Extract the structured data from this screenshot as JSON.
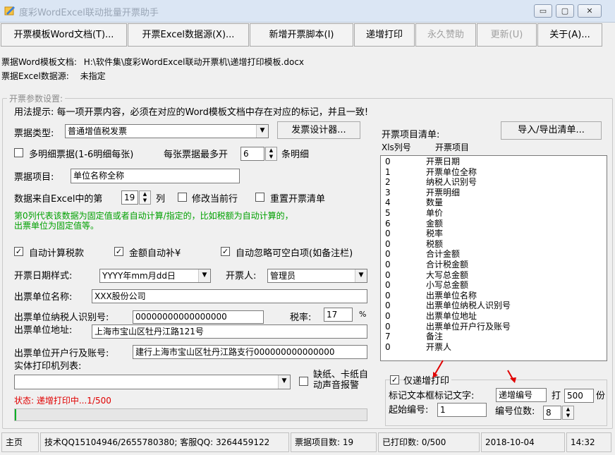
{
  "window": {
    "title": "度彩WordExcel联动批量开票助手",
    "min": "▭",
    "max": "▢",
    "close": "✕"
  },
  "toolbar": [
    {
      "label": "开票模板Word文档(T)..."
    },
    {
      "label": "开票Excel数据源(X)..."
    },
    {
      "label": "新增开票脚本(I)"
    },
    {
      "label": "递增打印"
    },
    {
      "label": "永久赞助"
    },
    {
      "label": "更新(U)"
    },
    {
      "label": "关于(A)..."
    }
  ],
  "info": {
    "template_label": "票据Word模板文档:",
    "template_value": "H:\\软件集\\度彩WordExcel联动开票机\\递增打印模板.docx",
    "source_label": "票据Excel数据源:",
    "source_value": "未指定"
  },
  "settings": {
    "group_title": "开票参数设置:",
    "hint": "用法提示: 每一项开票内容，必须在对应的Word模板文档中存在对应的标记，并且一致!",
    "type_label": "票据类型:",
    "type_value": "普通增值税发票",
    "designer_button": "发票设计器...",
    "multi_detail_label": "多明细票据(1-6明细每张)",
    "per_page_label": "每张票据最多开",
    "per_page_value": "6",
    "per_page_unit": "条明细",
    "item_label": "票据项目:",
    "item_value": "单位名称全称",
    "column_prefix": "数据来自Excel中的第",
    "column_value": "19",
    "column_suffix": "列",
    "modify_row_label": "修改当前行",
    "reset_list_label": "重置开票清单",
    "note_line1": "第0列代表该数据为固定值或者自动计算/指定的，比如税额为自动计算的，",
    "note_line2": "出票单位为固定值等。",
    "auto_tax_label": "自动计算税款",
    "auto_amount_label": "金额自动补¥",
    "auto_skip_label": "自动忽略可空白项(如备注栏)",
    "date_style_label": "开票日期样式:",
    "date_style_value": "YYYY年mm月dd日",
    "issuer_label": "开票人:",
    "issuer_value": "管理员",
    "org_name_label": "出票单位名称:",
    "org_name_value": "XXX股份公司",
    "taxid_label": "出票单位纳税人识别号:",
    "taxid_value": "00000000000000000",
    "tax_rate_label": "税率:",
    "tax_rate_value": "17",
    "tax_rate_unit": "%",
    "address_label": "出票单位地址:",
    "address_value": "上海市宝山区牡丹江路121号",
    "bank_label": "出票单位开户行及账号:",
    "bank_value": "建行上海市宝山区牡丹江路支行000000000000000",
    "printer_label": "实体打印机列表:",
    "printer_value": "",
    "paper_alarm_line1": "缺纸、卡纸自",
    "paper_alarm_line2": "动声音报警",
    "status_text": "状态: 递增打印中...1/500"
  },
  "list": {
    "title": "开票项目清单:",
    "import_export_button": "导入/导出清单...",
    "col_xls": "Xls列号",
    "col_item": "开票项目",
    "rows": [
      {
        "col": "0",
        "item": "开票日期"
      },
      {
        "col": "1",
        "item": "开票单位全称"
      },
      {
        "col": "2",
        "item": "纳税人识别号"
      },
      {
        "col": "3",
        "item": "开票明细"
      },
      {
        "col": "4",
        "item": "数量"
      },
      {
        "col": "5",
        "item": "单价"
      },
      {
        "col": "6",
        "item": "金额"
      },
      {
        "col": "0",
        "item": "税率"
      },
      {
        "col": "0",
        "item": "税额"
      },
      {
        "col": "0",
        "item": "合计金额"
      },
      {
        "col": "0",
        "item": "合计税金额"
      },
      {
        "col": "0",
        "item": "大写总金额"
      },
      {
        "col": "0",
        "item": "小写总金额"
      },
      {
        "col": "0",
        "item": "出票单位名称"
      },
      {
        "col": "0",
        "item": "出票单位纳税人识别号"
      },
      {
        "col": "0",
        "item": "出票单位地址"
      },
      {
        "col": "0",
        "item": "出票单位开户行及账号"
      },
      {
        "col": "7",
        "item": "备注"
      },
      {
        "col": "0",
        "item": "开票人"
      }
    ]
  },
  "increment": {
    "only_label": "仅递增打印",
    "mark_label": "标记文本框标记文字:",
    "mark_value": "递增编号",
    "print_label": "打",
    "count_value": "500",
    "count_unit": "份",
    "start_label": "起始编号:",
    "start_value": "1",
    "digits_label": "编号位数:",
    "digits_value": "8"
  },
  "statusbar": {
    "home": "主页",
    "support": "技术QQ15104946/2655780380; 客服QQ: 3264459122",
    "items_count": "票据项目数: 19",
    "printed": "已打印数: 0/500",
    "date": "2018-10-04",
    "time": "14:32"
  },
  "colors": {
    "accent_red": "#e00000",
    "note_green": "#00a000",
    "title_bg": "#dbe6f4"
  }
}
